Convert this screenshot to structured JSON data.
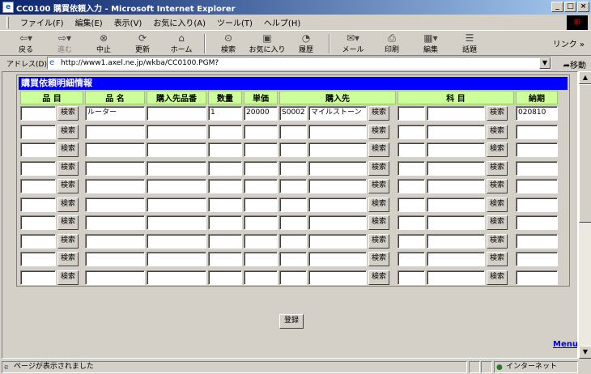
{
  "window": {
    "title": "CC0100 購買依頼入力 - Microsoft Internet Explorer"
  },
  "menu": [
    "ファイル(F)",
    "編集(E)",
    "表示(V)",
    "お気に入り(A)",
    "ツール(T)",
    "ヘルプ(H)"
  ],
  "toolbar": {
    "back": "戻る",
    "forward": "進む",
    "stop": "中止",
    "refresh": "更新",
    "home": "ホーム",
    "search": "検索",
    "favorites": "お気に入り",
    "history": "履歴",
    "mail": "メール",
    "print": "印刷",
    "edit": "編集",
    "discuss": "話題",
    "links": "リンク"
  },
  "address": {
    "label": "アドレス(D)",
    "url": "http://www1.axel.ne.jp/wkba/CC0100.PGM?",
    "go": "移動"
  },
  "panel": {
    "title": "購買依頼明細情報",
    "headers": [
      "品 目",
      "品 名",
      "購入先品番",
      "数量",
      "単価",
      "購入先",
      "科 目",
      "納期"
    ],
    "search_label": "検索",
    "rows": [
      {
        "item_code": "",
        "item_name": "ルーター",
        "vendor_part": "",
        "qty": "1",
        "price": "20000",
        "vendor_code": "S0002",
        "vendor_name": "マイルストーン",
        "account_code": "",
        "account_name": "",
        "due": "020810"
      },
      {
        "item_code": "",
        "item_name": "",
        "vendor_part": "",
        "qty": "",
        "price": "",
        "vendor_code": "",
        "vendor_name": "",
        "account_code": "",
        "account_name": "",
        "due": ""
      },
      {
        "item_code": "",
        "item_name": "",
        "vendor_part": "",
        "qty": "",
        "price": "",
        "vendor_code": "",
        "vendor_name": "",
        "account_code": "",
        "account_name": "",
        "due": ""
      },
      {
        "item_code": "",
        "item_name": "",
        "vendor_part": "",
        "qty": "",
        "price": "",
        "vendor_code": "",
        "vendor_name": "",
        "account_code": "",
        "account_name": "",
        "due": ""
      },
      {
        "item_code": "",
        "item_name": "",
        "vendor_part": "",
        "qty": "",
        "price": "",
        "vendor_code": "",
        "vendor_name": "",
        "account_code": "",
        "account_name": "",
        "due": ""
      },
      {
        "item_code": "",
        "item_name": "",
        "vendor_part": "",
        "qty": "",
        "price": "",
        "vendor_code": "",
        "vendor_name": "",
        "account_code": "",
        "account_name": "",
        "due": ""
      },
      {
        "item_code": "",
        "item_name": "",
        "vendor_part": "",
        "qty": "",
        "price": "",
        "vendor_code": "",
        "vendor_name": "",
        "account_code": "",
        "account_name": "",
        "due": ""
      },
      {
        "item_code": "",
        "item_name": "",
        "vendor_part": "",
        "qty": "",
        "price": "",
        "vendor_code": "",
        "vendor_name": "",
        "account_code": "",
        "account_name": "",
        "due": ""
      },
      {
        "item_code": "",
        "item_name": "",
        "vendor_part": "",
        "qty": "",
        "price": "",
        "vendor_code": "",
        "vendor_name": "",
        "account_code": "",
        "account_name": "",
        "due": ""
      },
      {
        "item_code": "",
        "item_name": "",
        "vendor_part": "",
        "qty": "",
        "price": "",
        "vendor_code": "",
        "vendor_name": "",
        "account_code": "",
        "account_name": "",
        "due": ""
      }
    ]
  },
  "register_label": "登録",
  "menu_link": "Menu",
  "status": {
    "text": "ページが表示されました",
    "zone": "インターネット"
  }
}
